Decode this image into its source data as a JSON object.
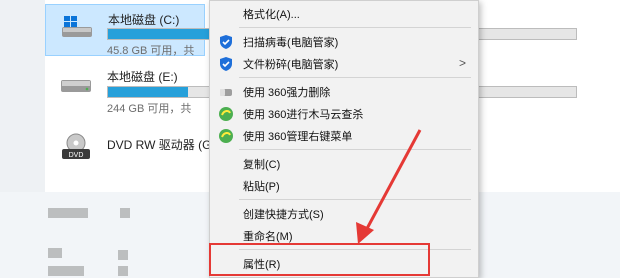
{
  "drives": [
    {
      "name": "本地磁盘 (C:)",
      "size": "45.8 GB 可用，共",
      "fill": 0.75,
      "fill_color": "#26a0da"
    },
    {
      "name": "本地磁盘 (E:)",
      "size": "244 GB 可用，共",
      "fill": 0.17,
      "fill_color": "#26a0da"
    },
    {
      "name": "DVD RW 驱动器 (G"
    }
  ],
  "menu": {
    "format": "格式化(A)...",
    "scan": "扫描病毒(电脑管家)",
    "shred": "文件粉碎(电脑管家)",
    "force_delete": "使用 360强力删除",
    "trojan_scan": "使用 360进行木马云查杀",
    "manage_menu": "使用 360管理右键菜单",
    "copy": "复制(C)",
    "paste": "粘贴(P)",
    "shortcut": "创建快捷方式(S)",
    "rename": "重命名(M)",
    "properties": "属性(R)",
    "submenu_arrow": ">"
  },
  "icons": {
    "drive": "hard-drive-icon",
    "dvd": "dvd-drive-icon",
    "shield": "shield-icon",
    "eraser": "eraser-icon",
    "fire360": "360-icon"
  },
  "colors": {
    "accent": "#26a0da",
    "selection": "#cce8ff",
    "highlight": "#e53935"
  }
}
